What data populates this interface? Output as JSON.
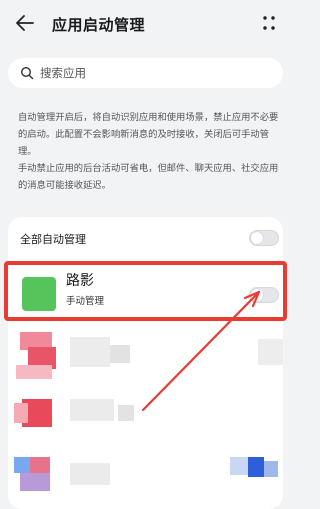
{
  "header": {
    "title": "应用启动管理",
    "back_icon": "back-arrow-icon",
    "more_icon": "more-dots-icon"
  },
  "search": {
    "placeholder": "搜索应用",
    "icon": "search-icon"
  },
  "description": {
    "paragraph1": "自动管理开启后，将自动识别应用和使用场景，禁止应用不必要的启动。此配置不会影响新消息的及时接收，关闭后可手动管理。",
    "paragraph2": "手动禁止应用的后台活动可省电，但邮件、聊天应用、社交应用的消息可能接收延迟。"
  },
  "app_list": {
    "all_auto_label": "全部自动管理",
    "all_auto_enabled": false,
    "highlighted_app": {
      "name": "路影",
      "mode": "手动管理",
      "enabled": false
    }
  },
  "colors": {
    "background": "#f1f3f5",
    "card": "#ffffff",
    "highlight": "#e83b32",
    "app_icon": "#55c45a"
  }
}
